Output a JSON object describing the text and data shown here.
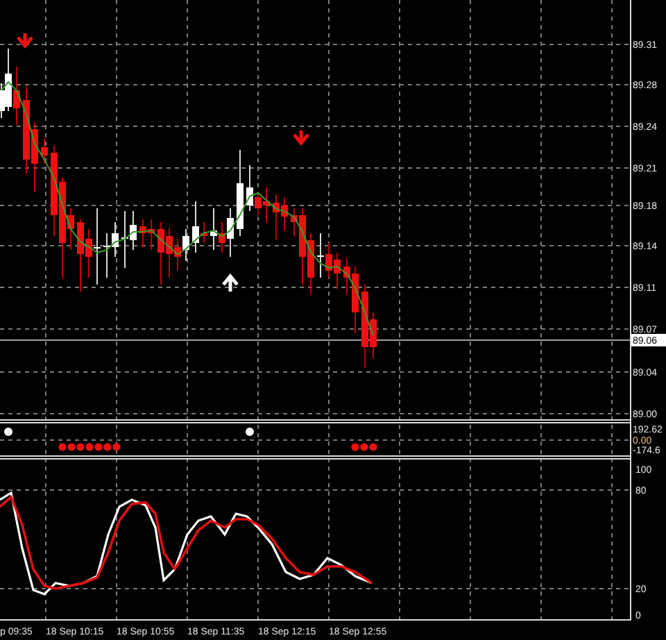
{
  "price_axis": {
    "labels": [
      {
        "text": "89.31",
        "kind": "tick"
      },
      {
        "text": "89.28",
        "kind": "tick"
      },
      {
        "text": "89.24",
        "kind": "tick"
      },
      {
        "text": "89.21",
        "kind": "tick"
      },
      {
        "text": "89.18",
        "kind": "tick"
      },
      {
        "text": "89.14",
        "kind": "tick"
      },
      {
        "text": "89.11",
        "kind": "tick"
      },
      {
        "text": "89.07",
        "kind": "tick"
      },
      {
        "text": "89.06",
        "kind": "current"
      },
      {
        "text": "89.04",
        "kind": "tick"
      },
      {
        "text": "89.00",
        "kind": "tick"
      }
    ]
  },
  "indicator_axis": {
    "labels": [
      "192.62",
      "0.00",
      "-174.6"
    ]
  },
  "oscillator_axis": {
    "labels": [
      "100",
      "80",
      "20",
      "0"
    ]
  },
  "time_axis": {
    "labels": [
      "p 09:35",
      "18 Sep 10:15",
      "18 Sep 10:55",
      "18 Sep 11:35",
      "18 Sep 12:15",
      "18 Sep 12:55"
    ]
  }
}
